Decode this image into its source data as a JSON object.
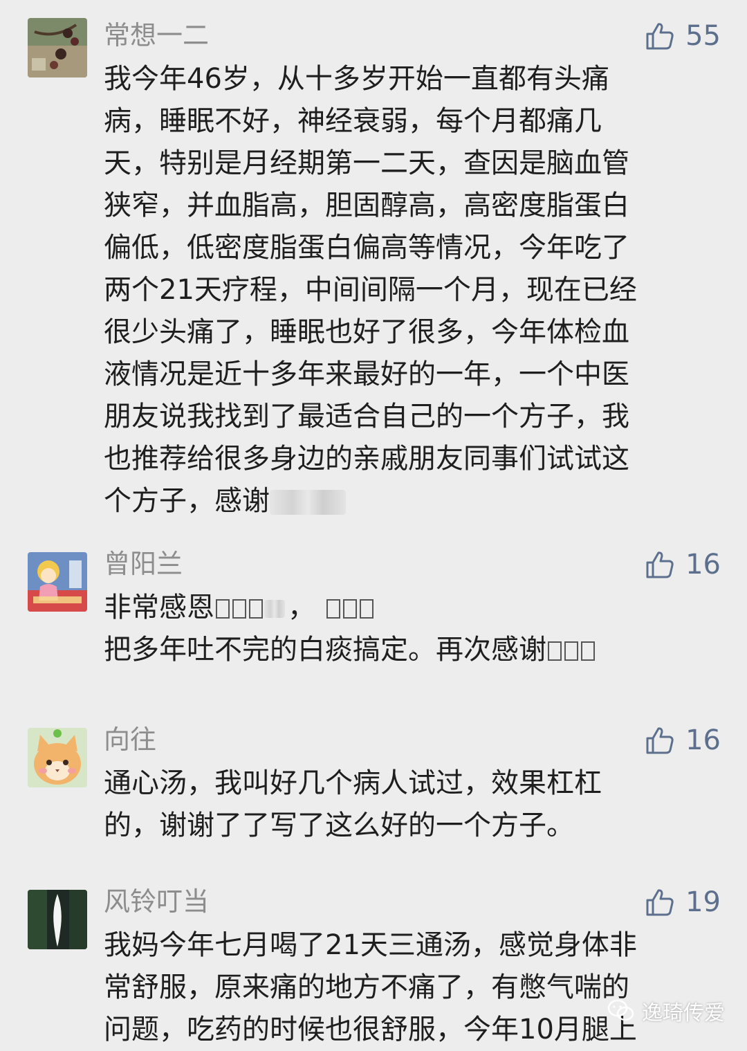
{
  "comments": [
    {
      "nickname": "常想一二",
      "likes": "55",
      "lines": [
        "我今年46岁，从十多岁开始一直都有头痛",
        "病，睡眠不好，神经衰弱，每个月都痛几",
        "天，特别是月经期第一二天，查因是脑血管",
        "狭窄，并血脂高，胆固醇高，高密度脂蛋白",
        "偏低，低密度脂蛋白偏高等情况，今年吃了",
        "两个21天疗程，中间间隔一个月，现在已经",
        "很少头痛了，睡眠也好了很多，今年体检血",
        "液情况是近十多年来最好的一年，一个中医",
        "朋友说我找到了最适合自己的一个方子，我",
        "也推荐给很多身边的亲戚朋友同事们试试这"
      ],
      "last_line": "个方子，感谢"
    },
    {
      "nickname": "曾阳兰",
      "likes": "16",
      "line1": "非常感恩",
      "line1_sep": "，",
      "line2": "把多年吐不完的白痰搞定。再次感谢"
    },
    {
      "nickname": "向往",
      "likes": "16",
      "lines": [
        "通心汤，我叫好几个病人试过，效果杠杠",
        "的，谢谢了了写了这么好的一个方子。"
      ]
    },
    {
      "nickname": "风铃叮当",
      "likes": "19",
      "lines": [
        "我妈今年七月喝了21天三通汤，感觉身体非",
        "常舒服，原来痛的地方不痛了，有憋气喘的",
        "问题，吃药的时候也很舒服，今年10月腿上"
      ]
    }
  ],
  "watermark": "逸琦传爱",
  "colors": {
    "background": "#ededed",
    "nickname": "#8d8d8d",
    "like": "#5c6f8c",
    "text": "#1e1e1e"
  }
}
